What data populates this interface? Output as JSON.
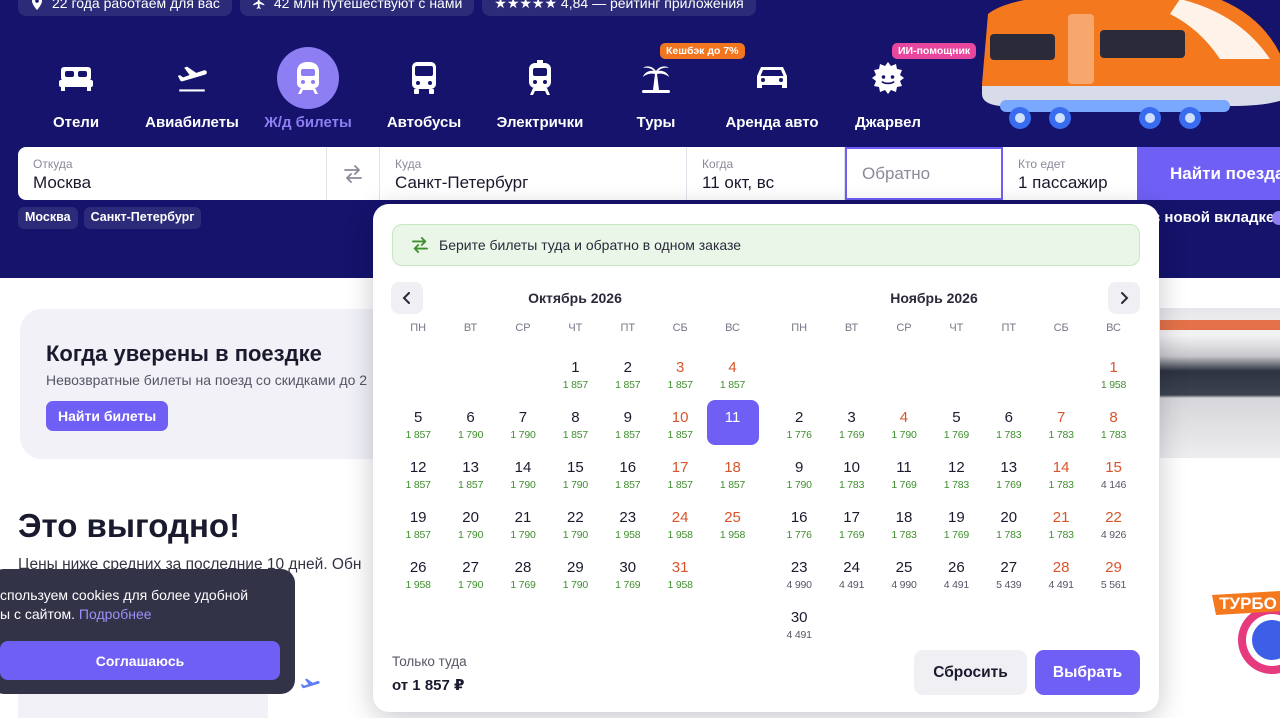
{
  "topbar": [
    {
      "icon": "location-icon",
      "text": "22 года работаем для вас"
    },
    {
      "icon": "plane-icon",
      "text": "42 млн путешествуют с нами"
    },
    {
      "icon": "stars-icon",
      "text": "★★★★★ 4,84 — рейтинг приложения"
    }
  ],
  "categories": [
    {
      "label": "Отели",
      "icon": "bed-icon",
      "active": false,
      "badge": ""
    },
    {
      "label": "Авиабилеты",
      "icon": "plane-icon",
      "active": false,
      "badge": ""
    },
    {
      "label": "Ж/д билеты",
      "icon": "train-icon",
      "active": true,
      "badge": ""
    },
    {
      "label": "Автобусы",
      "icon": "bus-icon",
      "active": false,
      "badge": ""
    },
    {
      "label": "Электрички",
      "icon": "commuter-train-icon",
      "active": false,
      "badge": ""
    },
    {
      "label": "Туры",
      "icon": "palm-icon",
      "active": false,
      "badge": "Кешбэк до 7%"
    },
    {
      "label": "Аренда авто",
      "icon": "car-icon",
      "active": false,
      "badge": ""
    },
    {
      "label": "Джарвел",
      "icon": "gear-icon",
      "active": false,
      "badge": "ИИ-помощник"
    }
  ],
  "search": {
    "from_label": "Откуда",
    "from_value": "Москва",
    "to_label": "Куда",
    "to_value": "Санкт-Петербург",
    "when_label": "Когда",
    "when_value": "11 окт, вс",
    "back_placeholder": "Обратно",
    "who_label": "Кто едет",
    "who_value": "1 пассажир",
    "find_label": "Найти поезда"
  },
  "recent_chips": [
    "Москва",
    "Санкт-Петербург"
  ],
  "new_tab_label": "в новой вкладке",
  "promo": {
    "title": "Когда уверены в поездке",
    "text": "Невозвратные билеты на поезд со скидками до 2",
    "button": "Найти билеты"
  },
  "deals": {
    "title": "Это выгодно!",
    "subtitle": "Цены ниже средних за последние 10 дней. Обн"
  },
  "cookie": {
    "text": "спользуем cookies для более удобной",
    "text2": "ы с сайтом.",
    "link": "Подробнее",
    "button": "Соглашаюсь"
  },
  "calendar": {
    "banner": "Берите билеты туда и обратно в одном заказе",
    "weekdays": [
      "пн",
      "вт",
      "ср",
      "чт",
      "пт",
      "сб",
      "вс"
    ],
    "selected_date": "11 окт",
    "months": [
      {
        "title": "Октябрь 2026",
        "offset": 3,
        "days": [
          {
            "d": "1",
            "p": "1 857"
          },
          {
            "d": "2",
            "p": "1 857"
          },
          {
            "d": "3",
            "p": "1 857"
          },
          {
            "d": "4",
            "p": "1 857"
          },
          {
            "d": "5",
            "p": "1 857"
          },
          {
            "d": "6",
            "p": "1 790"
          },
          {
            "d": "7",
            "p": "1 790"
          },
          {
            "d": "8",
            "p": "1 857"
          },
          {
            "d": "9",
            "p": "1 857"
          },
          {
            "d": "10",
            "p": "1 857"
          },
          {
            "d": "11",
            "p": "",
            "sel": true
          },
          {
            "d": "12",
            "p": "1 857"
          },
          {
            "d": "13",
            "p": "1 857"
          },
          {
            "d": "14",
            "p": "1 790"
          },
          {
            "d": "15",
            "p": "1 790"
          },
          {
            "d": "16",
            "p": "1 857"
          },
          {
            "d": "17",
            "p": "1 857"
          },
          {
            "d": "18",
            "p": "1 857"
          },
          {
            "d": "19",
            "p": "1 857"
          },
          {
            "d": "20",
            "p": "1 790"
          },
          {
            "d": "21",
            "p": "1 790"
          },
          {
            "d": "22",
            "p": "1 790"
          },
          {
            "d": "23",
            "p": "1 958"
          },
          {
            "d": "24",
            "p": "1 958"
          },
          {
            "d": "25",
            "p": "1 958"
          },
          {
            "d": "26",
            "p": "1 958"
          },
          {
            "d": "27",
            "p": "1 790"
          },
          {
            "d": "28",
            "p": "1 769"
          },
          {
            "d": "29",
            "p": "1 790"
          },
          {
            "d": "30",
            "p": "1 769"
          },
          {
            "d": "31",
            "p": "1 958"
          }
        ]
      },
      {
        "title": "Ноябрь 2026",
        "offset": 6,
        "days": [
          {
            "d": "1",
            "p": "1 958"
          },
          {
            "d": "2",
            "p": "1 776"
          },
          {
            "d": "3",
            "p": "1 769"
          },
          {
            "d": "4",
            "p": "1 790",
            "we": true
          },
          {
            "d": "5",
            "p": "1 769"
          },
          {
            "d": "6",
            "p": "1 783"
          },
          {
            "d": "7",
            "p": "1 783"
          },
          {
            "d": "8",
            "p": "1 783"
          },
          {
            "d": "9",
            "p": "1 790"
          },
          {
            "d": "10",
            "p": "1 783"
          },
          {
            "d": "11",
            "p": "1 769"
          },
          {
            "d": "12",
            "p": "1 783"
          },
          {
            "d": "13",
            "p": "1 769"
          },
          {
            "d": "14",
            "p": "1 783"
          },
          {
            "d": "15",
            "p": "4 146",
            "grey": true
          },
          {
            "d": "16",
            "p": "1 776"
          },
          {
            "d": "17",
            "p": "1 769"
          },
          {
            "d": "18",
            "p": "1 783"
          },
          {
            "d": "19",
            "p": "1 769"
          },
          {
            "d": "20",
            "p": "1 783"
          },
          {
            "d": "21",
            "p": "1 783"
          },
          {
            "d": "22",
            "p": "4 926",
            "grey": true
          },
          {
            "d": "23",
            "p": "4 990",
            "grey": true
          },
          {
            "d": "24",
            "p": "4 491",
            "grey": true
          },
          {
            "d": "25",
            "p": "4 990",
            "grey": true
          },
          {
            "d": "26",
            "p": "4 491",
            "grey": true
          },
          {
            "d": "27",
            "p": "5 439",
            "grey": true
          },
          {
            "d": "28",
            "p": "4 491",
            "grey": true
          },
          {
            "d": "29",
            "p": "5 561",
            "grey": true
          },
          {
            "d": "30",
            "p": "4 491",
            "grey": true
          }
        ]
      }
    ],
    "only_label": "Только туда",
    "only_price": "от 1 857 ₽",
    "reset_label": "Сбросить",
    "select_label": "Выбрать"
  },
  "turbo_label": "ТУРБО",
  "colors": {
    "hero_bg": "#15136b",
    "accent": "#6f5ff5",
    "accent_light": "#8e7ef3",
    "price_green": "#3f8f2e",
    "weekend_red": "#d9542b"
  }
}
